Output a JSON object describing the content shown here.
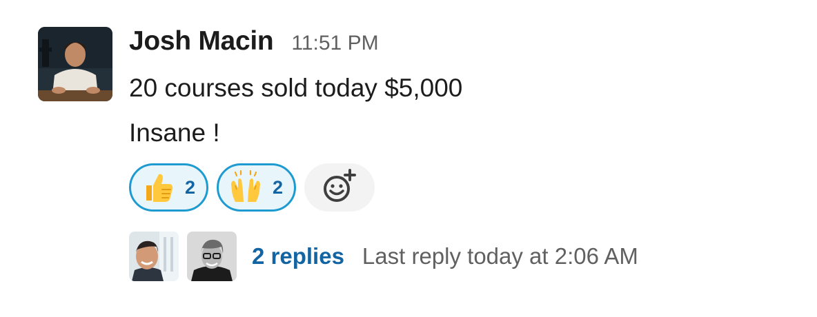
{
  "message": {
    "author": "Josh Macin",
    "timestamp": "11:51 PM",
    "lines": [
      "20 courses sold today $5,000",
      "Insane !"
    ]
  },
  "reactions": [
    {
      "emoji": "thumbs-up",
      "count": "2"
    },
    {
      "emoji": "raising-hands",
      "count": "2"
    }
  ],
  "add_reaction_icon": "add-reaction-icon",
  "thread": {
    "replies": "2 replies",
    "last_reply": "Last reply today at 2:06 AM"
  },
  "colors": {
    "link": "#1264a3",
    "reaction_border": "#1d9bd1",
    "reaction_bg": "#e8f5fa",
    "muted_text": "#616061"
  }
}
